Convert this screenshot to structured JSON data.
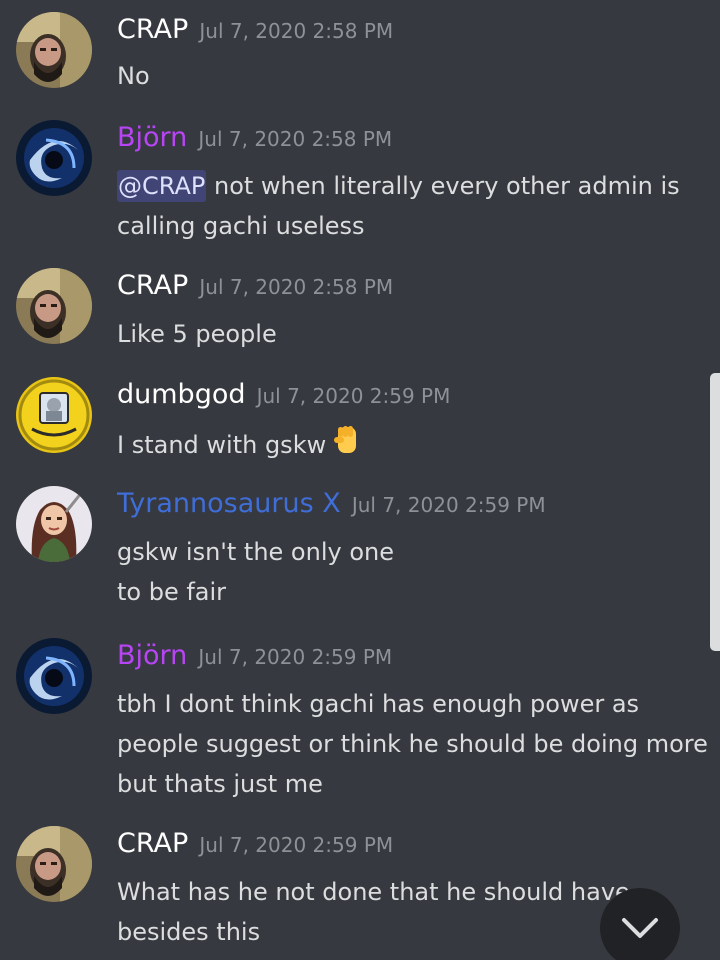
{
  "messages": [
    {
      "username": "CRAP",
      "username_color": "#ffffff",
      "timestamp": "Jul 7, 2020 2:58 PM",
      "lines": [
        "No"
      ]
    },
    {
      "username": "Björn",
      "username_color": "#b845f5",
      "timestamp": "Jul 7, 2020 2:58 PM",
      "mention": "@CRAP",
      "lines": [
        " not when literally every other admin is",
        "calling gachi useless"
      ]
    },
    {
      "username": "CRAP",
      "username_color": "#ffffff",
      "timestamp": "Jul 7, 2020 2:58 PM",
      "lines": [
        "Like 5 people"
      ]
    },
    {
      "username": "dumbgod",
      "username_color": "#ffffff",
      "timestamp": "Jul 7, 2020 2:59 PM",
      "lines": [
        "I stand with gskw"
      ],
      "emoji": "raised-fist-emoji"
    },
    {
      "username": "Tyrannosaurus X",
      "username_color": "#3f6ed8",
      "timestamp": "Jul 7, 2020 2:59 PM",
      "lines": [
        "gskw isn't the only one",
        "to be fair"
      ]
    },
    {
      "username": "Björn",
      "username_color": "#b845f5",
      "timestamp": "Jul 7, 2020 2:59 PM",
      "lines": [
        "tbh I dont think gachi has enough power as",
        "people suggest or think he should be doing more",
        "but thats just me"
      ]
    },
    {
      "username": "CRAP",
      "username_color": "#ffffff",
      "timestamp": "Jul 7, 2020 2:59 PM",
      "lines": [
        "What has he not done that he should have",
        "besides this"
      ]
    }
  ],
  "colors": {
    "background": "#36393f",
    "mention_bg": "#414775",
    "timestamp": "#8e9297",
    "jump_button": "#202225"
  },
  "icons": {
    "jump": "chevron-down-icon"
  }
}
